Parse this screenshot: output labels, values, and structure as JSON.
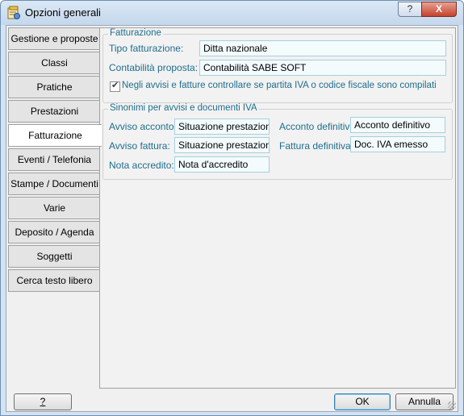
{
  "window": {
    "title": "Opzioni generali",
    "help_glyph": "?",
    "close_glyph": "X"
  },
  "tabs": [
    {
      "label": "Gestione e proposte"
    },
    {
      "label": "Classi"
    },
    {
      "label": "Pratiche"
    },
    {
      "label": "Prestazioni"
    },
    {
      "label": "Fatturazione",
      "active": true
    },
    {
      "label": "Eventi / Telefonia"
    },
    {
      "label": "Stampe / Documenti"
    },
    {
      "label": "Varie"
    },
    {
      "label": "Deposito / Agenda"
    },
    {
      "label": "Soggetti"
    },
    {
      "label": "Cerca testo libero"
    }
  ],
  "fatturazione": {
    "group_title": "Fatturazione",
    "tipo_label": "Tipo fatturazione:",
    "tipo_value": "Ditta nazionale",
    "contabilita_label": "Contabilità proposta:",
    "contabilita_value": "Contabilità SABE SOFT",
    "check_label": "Negli avvisi e fatture controllare se partita IVA o codice fiscale sono compilati",
    "checked": true
  },
  "sinonimi": {
    "group_title": "Sinonimi per avvisi e documenti IVA",
    "avviso_acconto_label": "Avviso acconto:",
    "avviso_acconto_value": "Situazione prestazione",
    "acconto_definitivo_label": "Acconto definitivo:",
    "acconto_definitivo_value": "Acconto definitivo",
    "avviso_fattura_label": "Avviso fattura:",
    "avviso_fattura_value": "Situazione prestazioni",
    "fattura_definitiva_label": "Fattura definitiva:",
    "fattura_definitiva_value": "Doc. IVA emesso",
    "nota_accredito_label": "Nota accredito:",
    "nota_accredito_value": "Nota d'accredito"
  },
  "buttons": {
    "help": "?",
    "ok": "OK",
    "cancel": "Annulla"
  }
}
